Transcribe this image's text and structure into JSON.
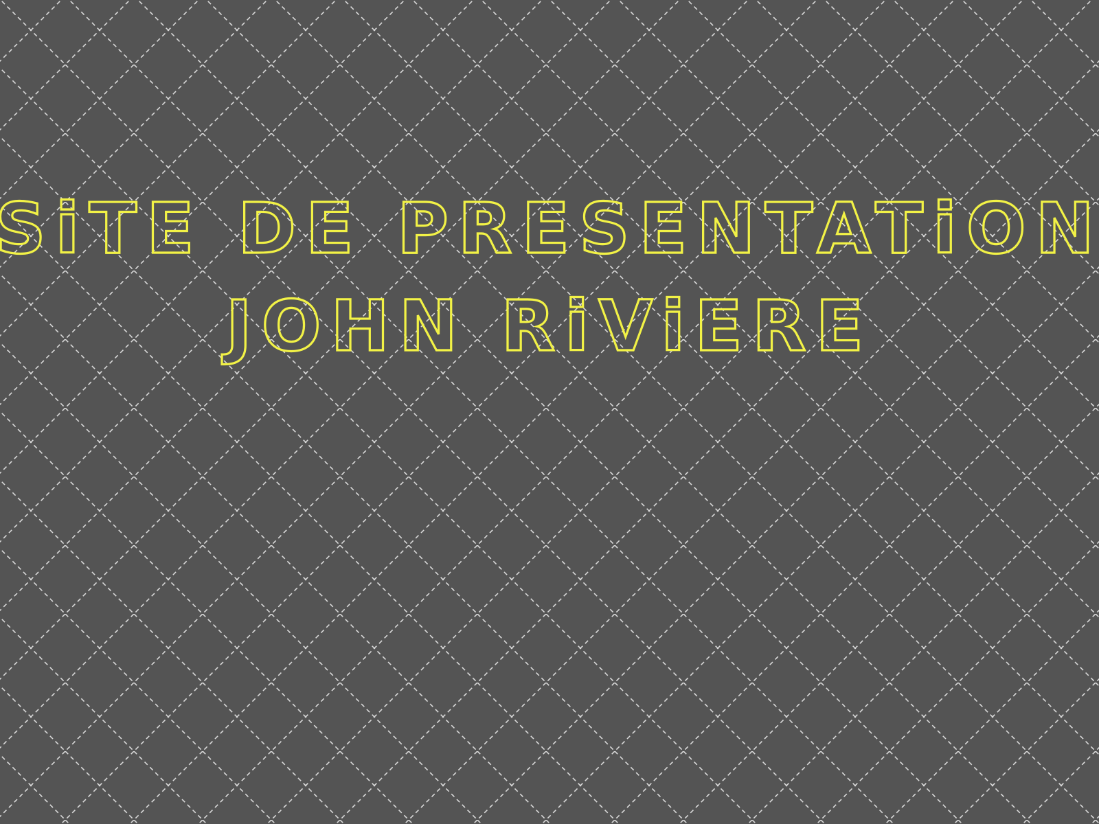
{
  "page": {
    "title_line_1": "SiTE DE PRESENTATiON",
    "title_line_2": "JOHN RiViERE"
  },
  "colors": {
    "background": "#545454",
    "pattern_lines": "#d9d9d9",
    "title_outline": "#f2f246"
  }
}
